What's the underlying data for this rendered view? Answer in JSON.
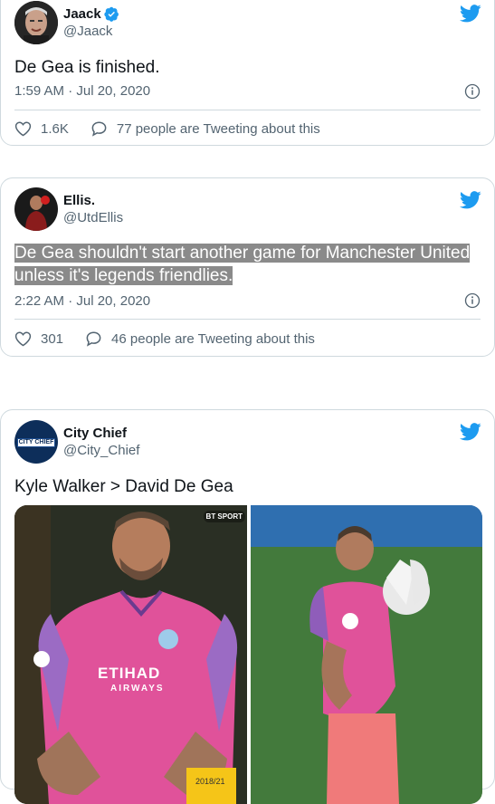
{
  "tweets": [
    {
      "name": "Jaack",
      "handle": "@Jaack",
      "verified": true,
      "text": "De Gea is finished.",
      "timestamp": "1:59 AM · Jul 20, 2020",
      "likes": "1.6K",
      "talking": "77 people are Tweeting about this"
    },
    {
      "name": "Ellis.",
      "handle": "@UtdEllis",
      "verified": false,
      "text_line1": "De Gea shouldn't start another game for Manchester United",
      "text_line2": "unless it's legends friendlies.",
      "timestamp": "2:22 AM · Jul 20, 2020",
      "likes": "301",
      "talking": "46 people are Tweeting about this"
    },
    {
      "name": "City Chief",
      "handle": "@City_Chief",
      "verified": false,
      "avatar_text": "CITY CHIEF",
      "text": "Kyle Walker > David De Gea",
      "media": {
        "left": {
          "sponsor": "ETIHAD",
          "sponsor_sub": "AIRWAYS",
          "card_text": "2018/21",
          "broadcaster": "BT SPORT"
        },
        "right": {}
      }
    }
  ],
  "colors": {
    "twitter_blue": "#1d9bf0",
    "text_secondary": "#536471",
    "border": "#cfd9de",
    "highlight": "#8a8a8a",
    "kit_pink": "#e0529a"
  },
  "icons": [
    "twitter-bird-icon",
    "verified-badge-icon",
    "info-icon",
    "heart-icon",
    "reply-bubble-icon"
  ]
}
